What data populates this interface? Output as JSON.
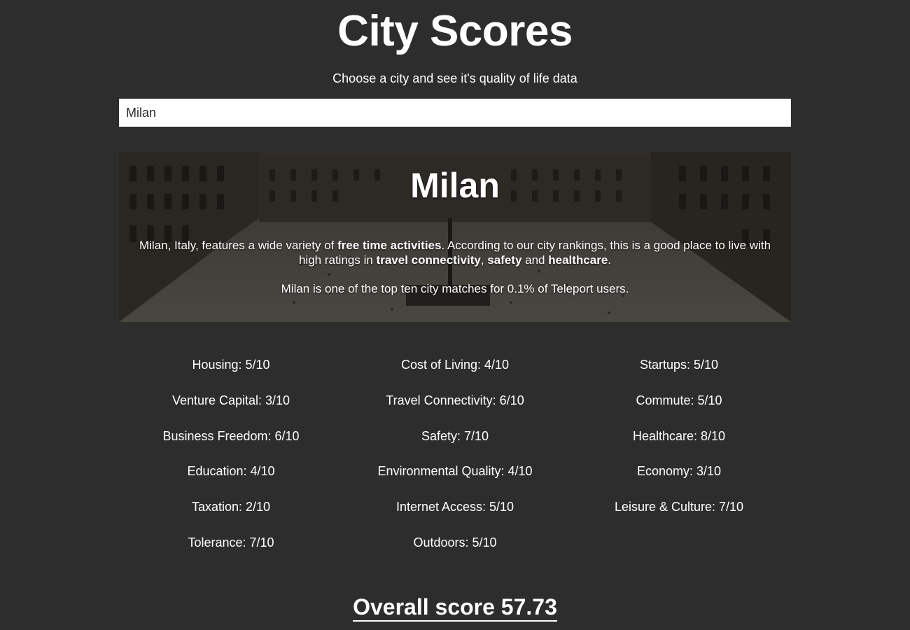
{
  "header": {
    "title": "City Scores",
    "subtitle": "Choose a city and see it's quality of life data"
  },
  "search": {
    "value": "Milan"
  },
  "city": {
    "name": "Milan",
    "summary_parts": [
      {
        "text": "Milan, Italy, features a wide variety of ",
        "bold": false
      },
      {
        "text": "free time activities",
        "bold": true
      },
      {
        "text": ". According to our city rankings, this is a good place to live with high ratings in ",
        "bold": false
      },
      {
        "text": "travel connectivity",
        "bold": true
      },
      {
        "text": ", ",
        "bold": false
      },
      {
        "text": "safety",
        "bold": true
      },
      {
        "text": " and ",
        "bold": false
      },
      {
        "text": "healthcare",
        "bold": true
      },
      {
        "text": ".",
        "bold": false
      }
    ],
    "match_text": "Milan is one of the top ten city matches for 0.1% of Teleport users."
  },
  "scores": [
    "Housing: 5/10",
    "Cost of Living: 4/10",
    "Startups: 5/10",
    "Venture Capital: 3/10",
    "Travel Connectivity: 6/10",
    "Commute: 5/10",
    "Business Freedom: 6/10",
    "Safety: 7/10",
    "Healthcare: 8/10",
    "Education: 4/10",
    "Environmental Quality: 4/10",
    "Economy: 3/10",
    "Taxation: 2/10",
    "Internet Access: 5/10",
    "Leisure & Culture: 7/10",
    "Tolerance: 7/10",
    "Outdoors: 5/10"
  ],
  "overall": {
    "text": "Overall score 57.73"
  },
  "colors": {
    "background": "#2d2d2d",
    "text": "#ffffff",
    "input_background": "#ffffff",
    "input_text": "#2b2b2b"
  }
}
